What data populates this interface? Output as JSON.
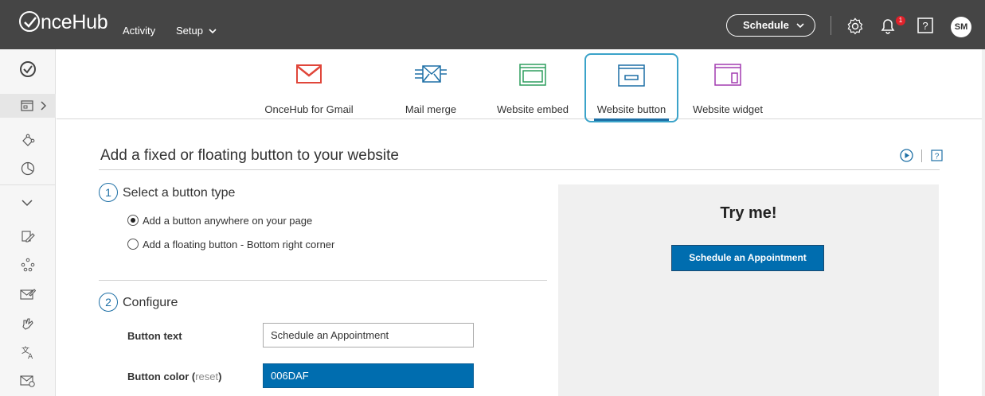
{
  "header": {
    "logo_text": "nceHub",
    "nav": [
      {
        "label": "Activity"
      },
      {
        "label": "Setup"
      }
    ],
    "schedule_button": "Schedule",
    "notification_count": "1",
    "user_initials": "SM",
    "icons": [
      "gear-icon",
      "bell-icon",
      "help-icon",
      "chevron-down-icon"
    ]
  },
  "sidebar": {
    "icons": [
      "check-circle-icon",
      "website-icon",
      "chevron-right-icon",
      "puzzle-icon",
      "pie-chart-icon",
      "chevron-down-icon",
      "edit-icon",
      "people-icon",
      "envelope-edit-icon",
      "hand-icon",
      "translate-icon",
      "envelope-settings-icon"
    ]
  },
  "tabs": [
    {
      "label": "OnceHub for Gmail",
      "icon": "gmail-icon",
      "color": "#e0463a"
    },
    {
      "label": "Mail merge",
      "icon": "mail-merge-icon",
      "color": "#1d6fa5"
    },
    {
      "label": "Website embed",
      "icon": "website-embed-icon",
      "color": "#2e9e5f"
    },
    {
      "label": "Website button",
      "icon": "website-button-icon",
      "color": "#1d6fa5",
      "active": true
    },
    {
      "label": "Website widget",
      "icon": "website-widget-icon",
      "color": "#a23bb0"
    }
  ],
  "main": {
    "title": "Add a fixed or floating button to your website",
    "step1": {
      "number": "1",
      "title": "Select a button type",
      "options": [
        {
          "label": "Add a button anywhere on your page",
          "checked": true
        },
        {
          "label": "Add a floating button - Bottom right corner",
          "checked": false
        }
      ]
    },
    "step2": {
      "number": "2",
      "title": "Configure",
      "button_text_label": "Button text",
      "button_text_value": "Schedule an Appointment",
      "button_color_label": "Button color (",
      "button_color_reset": "reset",
      "button_color_close": ")",
      "button_color_value": "006DAF"
    }
  },
  "preview": {
    "title": "Try me!",
    "button_label": "Schedule an Appointment"
  },
  "colors": {
    "topbar": "#454545",
    "accent": "#1d6fa5",
    "button_color": "#006DAF"
  }
}
